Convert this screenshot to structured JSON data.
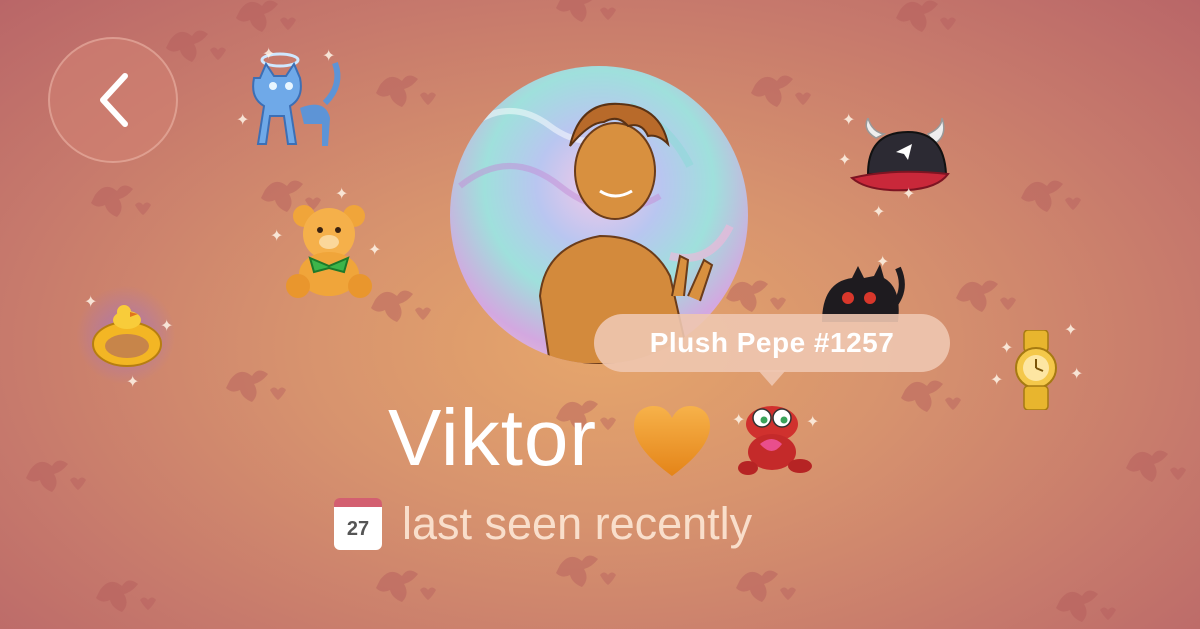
{
  "header": {
    "back_icon": "chevron-left-icon"
  },
  "profile": {
    "name": "Viktor",
    "name_emoji_icon": "orange-heart-icon",
    "status_text": "last seen recently",
    "calendar_day": "27"
  },
  "tooltip": {
    "label": "Plush Pepe #1257"
  },
  "gifts": [
    {
      "icon": "angel-cat-icon"
    },
    {
      "icon": "teddy-bear-icon"
    },
    {
      "icon": "duck-ring-icon"
    },
    {
      "icon": "horned-cap-icon"
    },
    {
      "icon": "black-cat-icon"
    },
    {
      "icon": "gold-watch-icon"
    },
    {
      "icon": "plush-pepe-icon"
    }
  ],
  "colors": {
    "accent_heart": "#f39a2a",
    "background_center": "#e6a66b",
    "background_edge": "#b96668",
    "calendar_red": "#d35f70"
  }
}
